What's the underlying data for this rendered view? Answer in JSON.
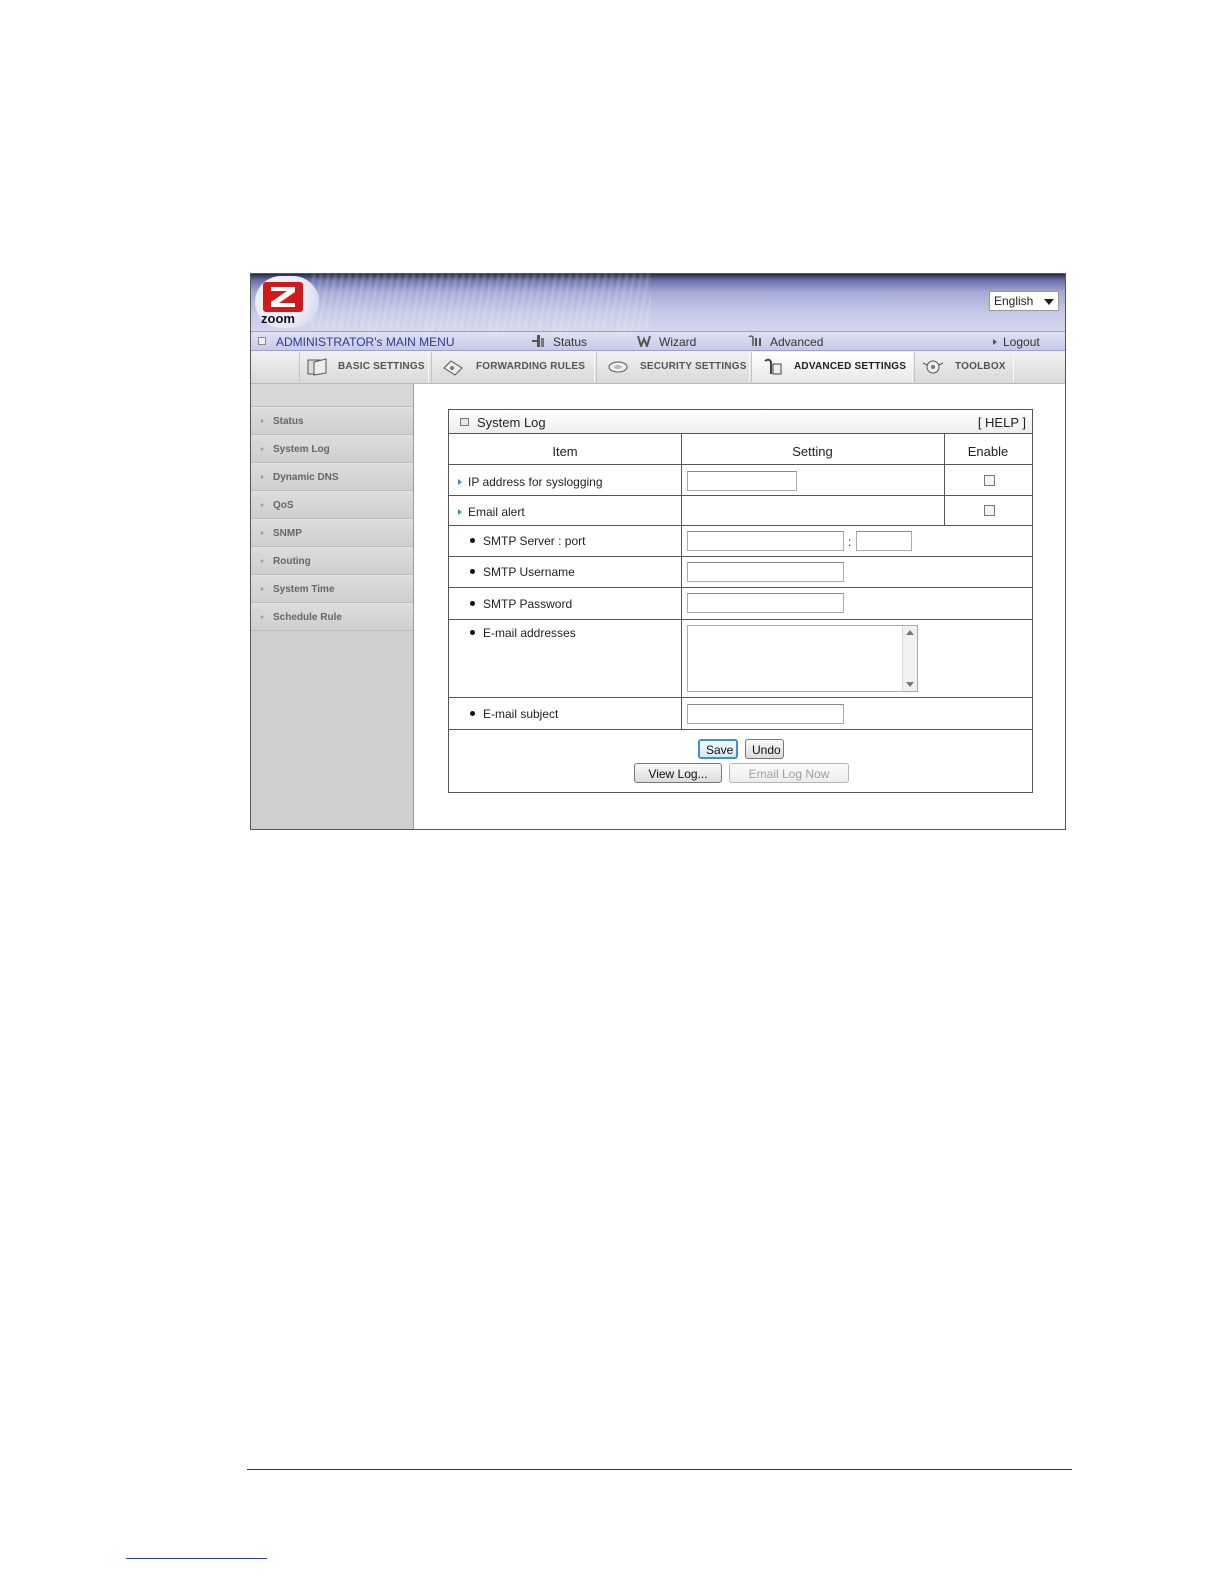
{
  "header": {
    "logo_text": "zoom",
    "language": "English"
  },
  "menu": {
    "title": "ADMINISTRATOR's MAIN MENU",
    "status": "Status",
    "wizard": "Wizard",
    "advanced": "Advanced",
    "logout": "Logout"
  },
  "tabs": {
    "basic": "BASIC SETTINGS",
    "forwarding": "FORWARDING RULES",
    "security": "SECURITY SETTINGS",
    "advanced": "ADVANCED SETTINGS",
    "toolbox": "TOOLBOX",
    "active": "advanced"
  },
  "sidebar": {
    "items": [
      "Status",
      "System Log",
      "Dynamic DNS",
      "QoS",
      "SNMP",
      "Routing",
      "System Time",
      "Schedule Rule"
    ]
  },
  "panel": {
    "title": "System Log",
    "help": "[ HELP ]",
    "col_item": "Item",
    "col_setting": "Setting",
    "col_enable": "Enable",
    "rows": {
      "ip_label": "IP address for syslogging",
      "email_alert_label": "Email alert",
      "smtp_server_label": "SMTP Server : port",
      "smtp_username_label": "SMTP Username",
      "smtp_password_label": "SMTP Password",
      "email_addresses_label": "E-mail addresses",
      "email_subject_label": "E-mail subject"
    },
    "port_separator": ":",
    "values": {
      "ip": "",
      "smtp_server": "",
      "smtp_port": "",
      "smtp_username": "",
      "smtp_password": "",
      "email_addresses": "",
      "email_subject": ""
    },
    "buttons": {
      "save": "Save",
      "undo": "Undo",
      "view_log": "View Log...",
      "email_log_now": "Email Log Now"
    }
  },
  "colors": {
    "menu_title": "#2a3a9a",
    "logo_red": "#d11a1a",
    "bullet_blue": "#3c8fbf",
    "focus_border": "#3f92c9"
  }
}
